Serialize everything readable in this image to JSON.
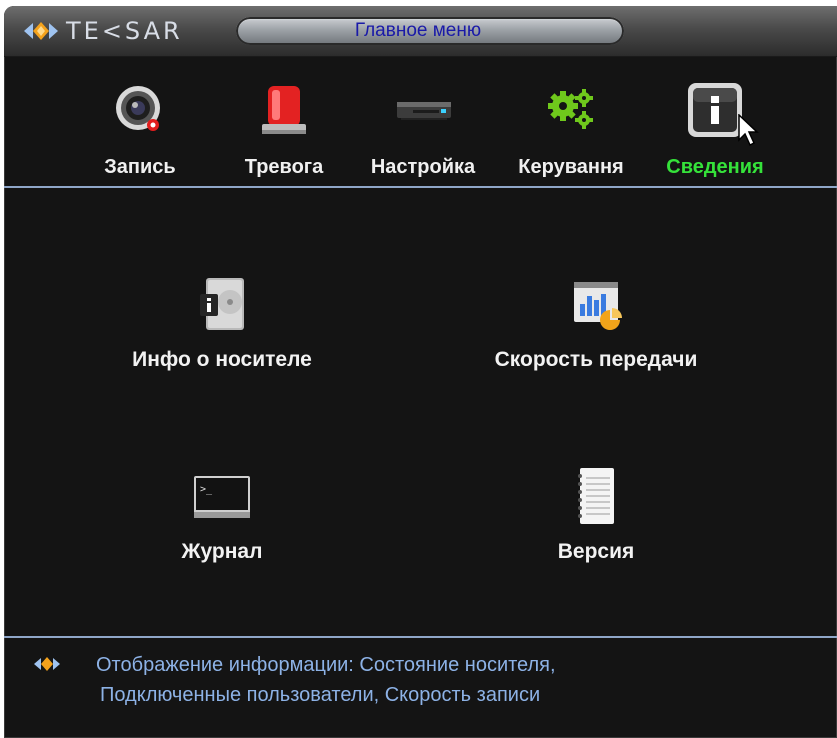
{
  "app": {
    "logo_text": "TE<SAR",
    "window_title": "Главное меню"
  },
  "nav": {
    "items": [
      {
        "label": "Запись",
        "icon": "record-camera-icon"
      },
      {
        "label": "Тревога",
        "icon": "alarm-siren-icon"
      },
      {
        "label": "Настройка",
        "icon": "settings-device-icon"
      },
      {
        "label": "Керування",
        "icon": "gears-icon"
      },
      {
        "label": "Сведения",
        "icon": "info-icon",
        "active": true
      }
    ]
  },
  "main": {
    "tiles": [
      {
        "label": "Инфо о носителе",
        "icon": "hdd-info-icon"
      },
      {
        "label": "Скорость передачи",
        "icon": "bitrate-chart-icon"
      },
      {
        "label": "Журнал",
        "icon": "log-terminal-icon"
      },
      {
        "label": "Версия",
        "icon": "version-notepad-icon"
      }
    ]
  },
  "hint": {
    "line1": "Отображение информации: Состояние носителя,",
    "line2": "Подключенные пользователи, Скорость записи"
  },
  "colors": {
    "background": "#141414",
    "active_label": "#35e23a",
    "title_text": "#1a1aa8",
    "hint_text": "#8db2e6",
    "separator": "#8fa6c8"
  }
}
